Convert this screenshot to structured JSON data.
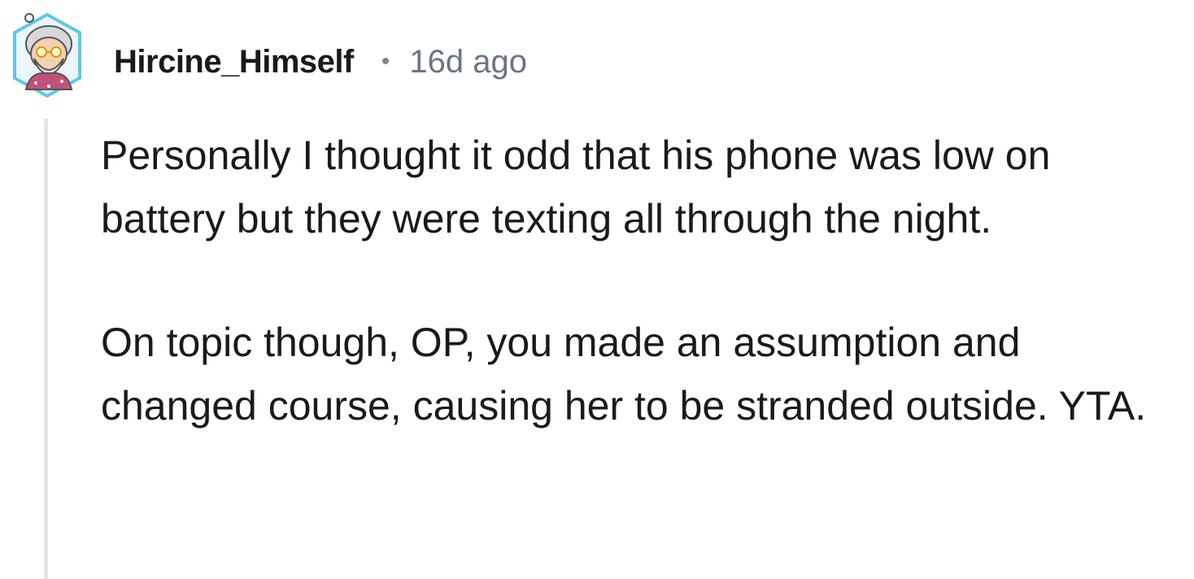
{
  "comment": {
    "author": "Hircine_Himself",
    "separator": "•",
    "timestamp": "16d ago",
    "paragraphs": [
      "Personally I thought it odd that his phone was low on battery but they were texting all through the night.",
      "On topic though, OP, you made an assumption and changed course, causing her to be stranded outside. YTA."
    ]
  },
  "colors": {
    "text": "#1a1a1b",
    "meta": "#6a7580",
    "thread_line": "#e6e6e6",
    "avatar_border": "#5ec8e6",
    "avatar_shirt": "#c2527a"
  },
  "icons": {
    "avatar": "user-avatar-icon"
  }
}
